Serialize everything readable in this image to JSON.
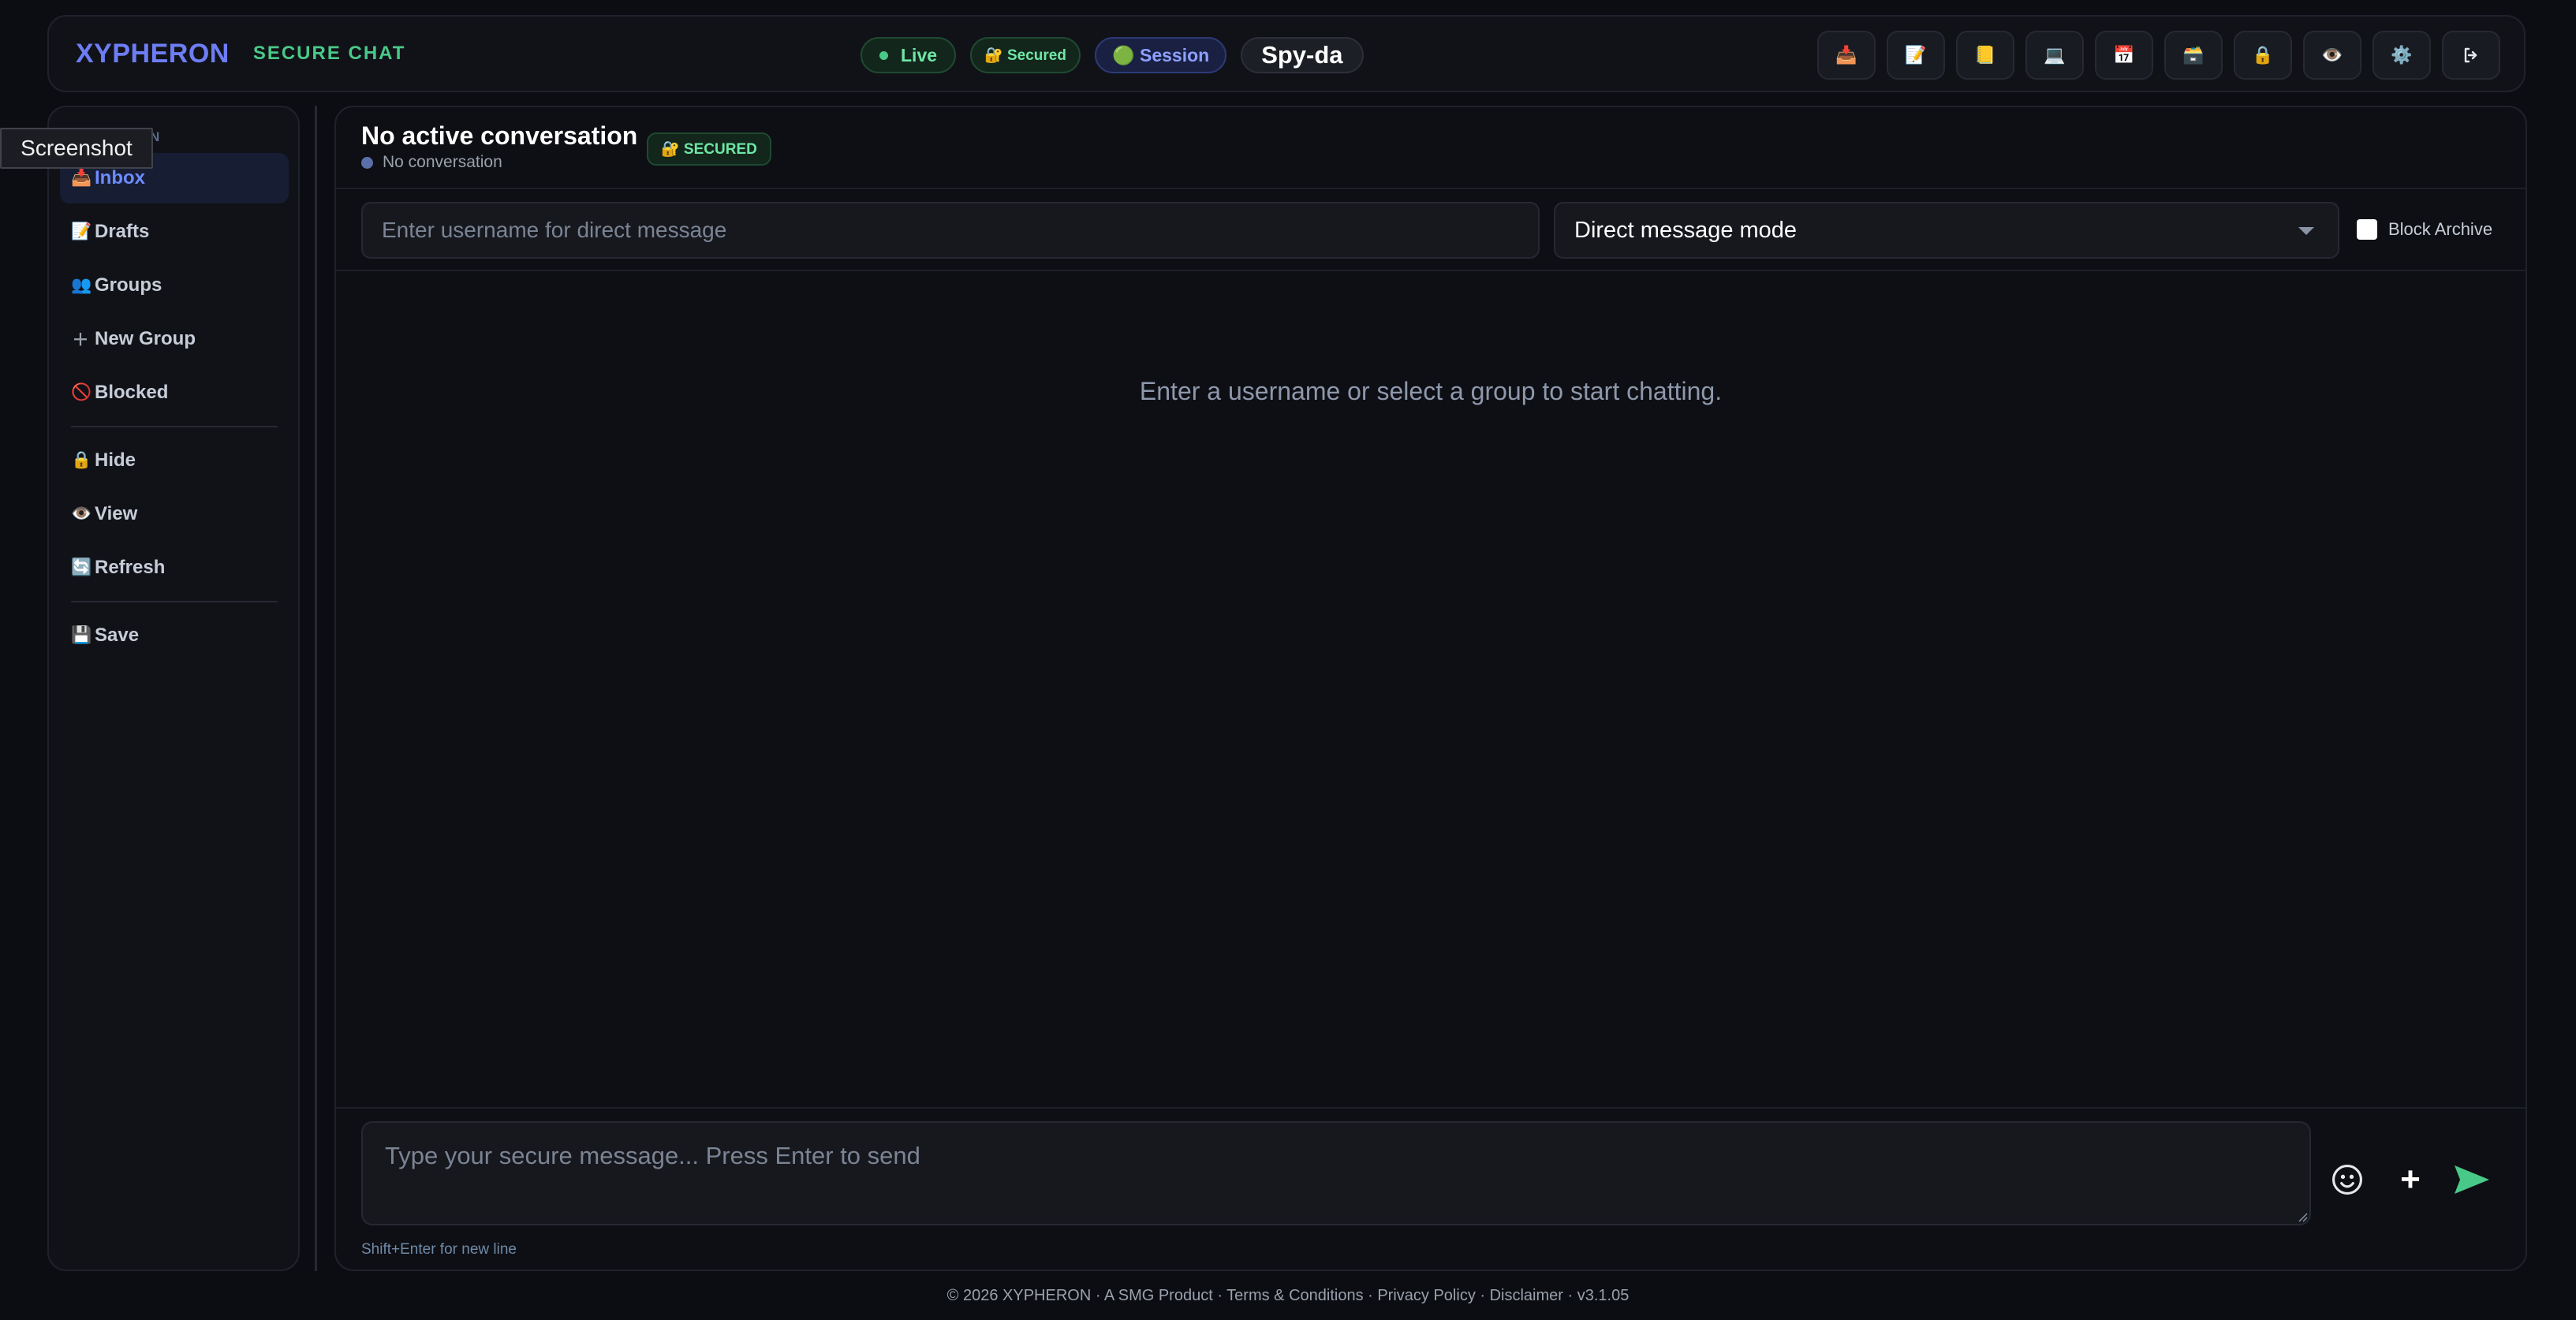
{
  "header": {
    "brand": "XYPHERON",
    "brand_subtitle": "SECURE CHAT",
    "badges": {
      "live": "Live",
      "secured": "🔐 Secured",
      "session": "🟢 Session",
      "user": "Spy-da"
    },
    "tools": [
      "📥",
      "📝",
      "📒",
      "💻",
      "📅",
      "🗃️",
      "🔒",
      "👁️",
      "⚙️"
    ],
    "tool_icon_names": [
      "inbox-tray-icon",
      "memo-icon",
      "notebook-icon",
      "laptop-icon",
      "calendar-icon",
      "card-box-icon",
      "lock-icon",
      "eye-icon",
      "gear-icon",
      "logout-icon"
    ]
  },
  "tooltip": "Screenshot",
  "sidebar": {
    "heading": "N",
    "items": [
      {
        "icon": "📥",
        "label": "Inbox"
      },
      {
        "icon": "📝",
        "label": "Drafts"
      },
      {
        "icon": "👥",
        "label": "Groups"
      },
      {
        "icon": "＋",
        "label": "New Group"
      },
      {
        "icon": "🚫",
        "label": "Blocked"
      },
      {
        "icon": "🔒",
        "label": "Hide"
      },
      {
        "icon": "👁️",
        "label": "View"
      },
      {
        "icon": "🔄",
        "label": "Refresh"
      },
      {
        "icon": "💾",
        "label": "Save"
      }
    ]
  },
  "conversation": {
    "title": "No active conversation",
    "badge": "🔐 SECURED",
    "subtitle": "No conversation",
    "dm_placeholder": "Enter username for direct message",
    "mode_selected": "Direct message mode",
    "archive_label": "Block Archive",
    "empty_message": "Enter a username or select a group to start chatting."
  },
  "composer": {
    "placeholder": "Type your secure message... Press Enter to send",
    "hint": "Shift+Enter for new line",
    "plus": "+"
  },
  "footer": "© 2026 XYPHERON · A SMG Product · Terms & Conditions · Privacy Policy · Disclaimer · v3.1.05",
  "colors": {
    "accent": "#6d7df4",
    "success": "#49c988",
    "background": "#0c0d12",
    "panel": "#111218"
  }
}
